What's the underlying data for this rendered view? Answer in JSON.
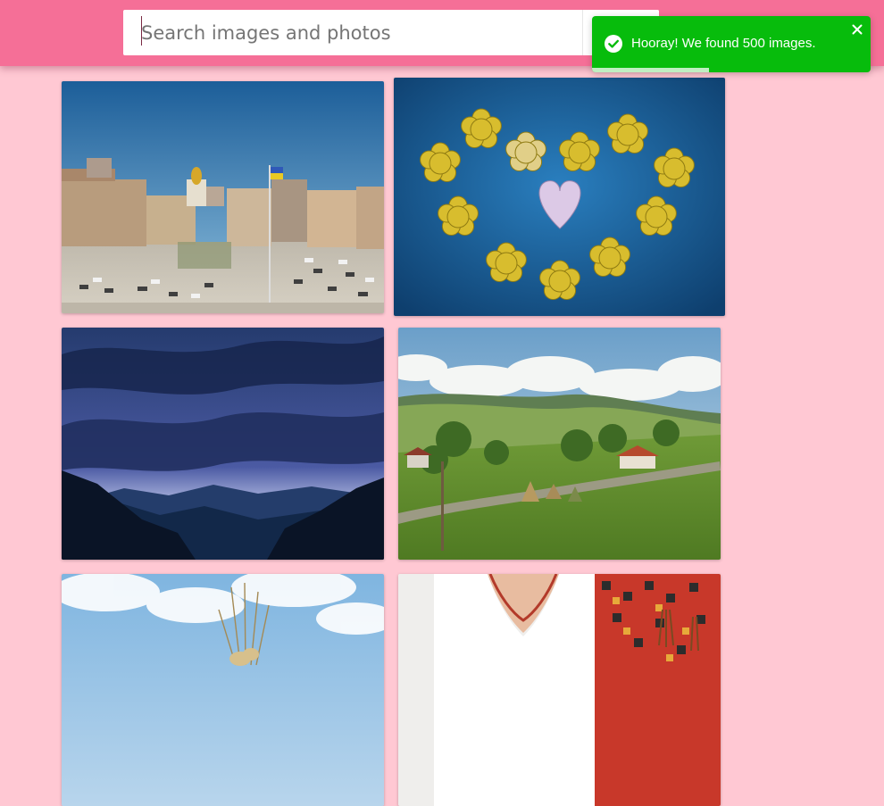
{
  "search": {
    "placeholder": "Search images and photos",
    "value": "",
    "button_icon": "search-icon"
  },
  "toast": {
    "message": "Hooray! We found 500 images.",
    "icon": "check-circle-icon",
    "close_icon": "close-icon",
    "progress": 0.42,
    "color": "#07bc0c"
  },
  "theme": {
    "header_color": "#f56f97",
    "background_color": "#ffc8d3"
  },
  "gallery": {
    "images": [
      {
        "subject": "Kyiv city square with Ukrainian flag"
      },
      {
        "subject": "Yellow wooden flowers forming a heart on blue wood"
      },
      {
        "subject": "Stormy clouds over dark forested mountains"
      },
      {
        "subject": "Green hills, haystacks and village in summer"
      },
      {
        "subject": "Wheat ears against blue sky"
      },
      {
        "subject": "Embroidered vyshyvanka shirt"
      }
    ]
  }
}
